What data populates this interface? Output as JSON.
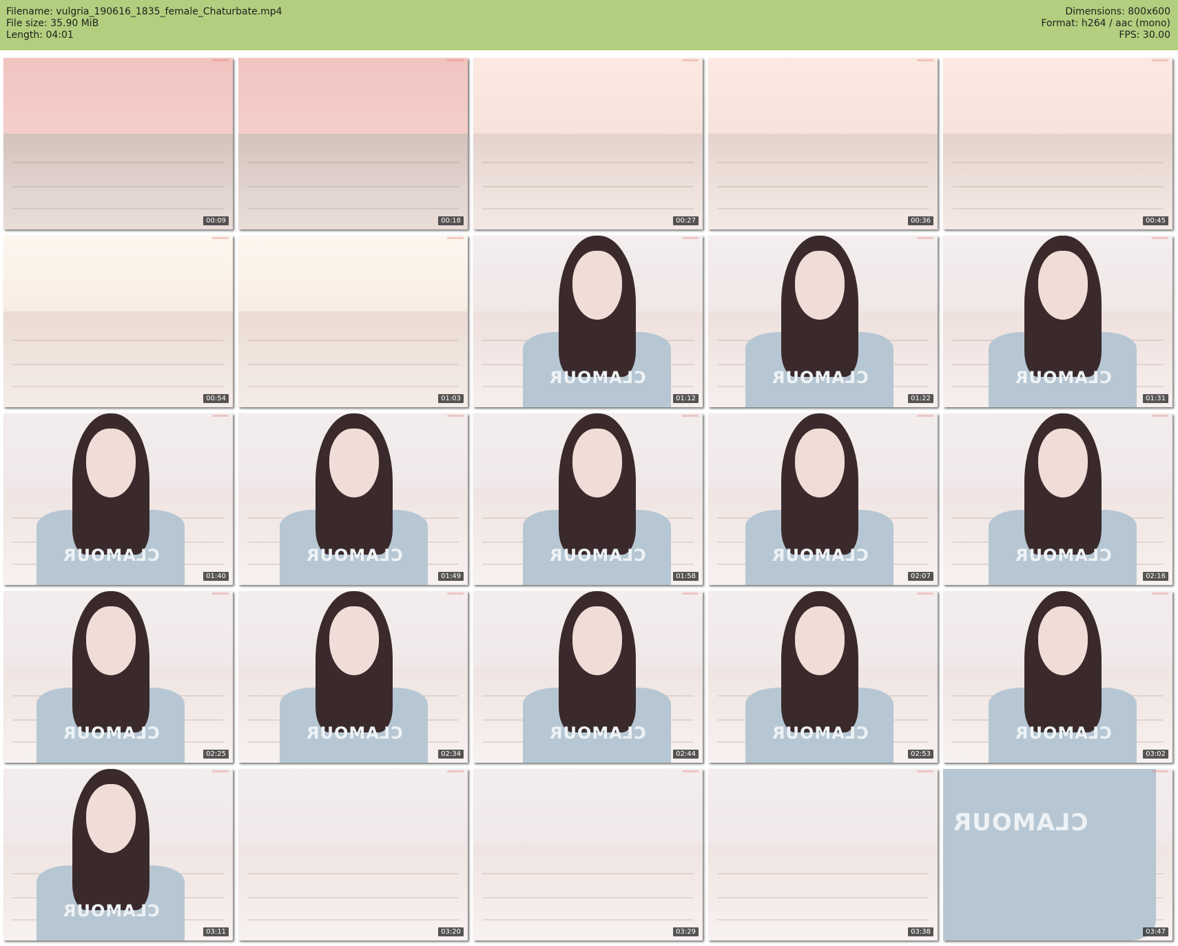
{
  "header": {
    "filename": "Filename: vulgria_190616_1835_female_Chaturbate.mp4",
    "filesize": "File size: 35.90 MiB",
    "length": "Length: 04:01",
    "dimensions": "Dimensions: 800x600",
    "format": "Format: h264 / aac (mono)",
    "fps": "FPS: 30.00",
    "background_color": "#b2cf7f"
  },
  "shirt_print": "CLAMOUR",
  "thumbnails": [
    {
      "time": "00:09",
      "shade": "a",
      "person": false
    },
    {
      "time": "00:18",
      "shade": "a",
      "person": false
    },
    {
      "time": "00:27",
      "shade": "b",
      "person": false
    },
    {
      "time": "00:36",
      "shade": "b",
      "person": false
    },
    {
      "time": "00:45",
      "shade": "b",
      "person": false
    },
    {
      "time": "00:54",
      "shade": "c",
      "person": false
    },
    {
      "time": "01:03",
      "shade": "c",
      "person": false
    },
    {
      "time": "01:12",
      "shade": "d",
      "person": true
    },
    {
      "time": "01:22",
      "shade": "d",
      "person": true
    },
    {
      "time": "01:31",
      "shade": "d",
      "person": true
    },
    {
      "time": "01:40",
      "shade": "e",
      "person": true
    },
    {
      "time": "01:49",
      "shade": "e",
      "person": true
    },
    {
      "time": "01:58",
      "shade": "e",
      "person": true
    },
    {
      "time": "02:07",
      "shade": "e",
      "person": true
    },
    {
      "time": "02:16",
      "shade": "e",
      "person": true
    },
    {
      "time": "02:25",
      "shade": "e",
      "person": true
    },
    {
      "time": "02:34",
      "shade": "e",
      "person": true
    },
    {
      "time": "02:44",
      "shade": "e",
      "person": true
    },
    {
      "time": "02:53",
      "shade": "e",
      "person": true
    },
    {
      "time": "03:02",
      "shade": "e",
      "person": true
    },
    {
      "time": "03:11",
      "shade": "e",
      "person": true
    },
    {
      "time": "03:20",
      "shade": "e",
      "person": false
    },
    {
      "time": "03:29",
      "shade": "e",
      "person": false
    },
    {
      "time": "03:38",
      "shade": "e",
      "person": false
    },
    {
      "time": "03:47",
      "shade": "e",
      "person": "closeup"
    }
  ]
}
